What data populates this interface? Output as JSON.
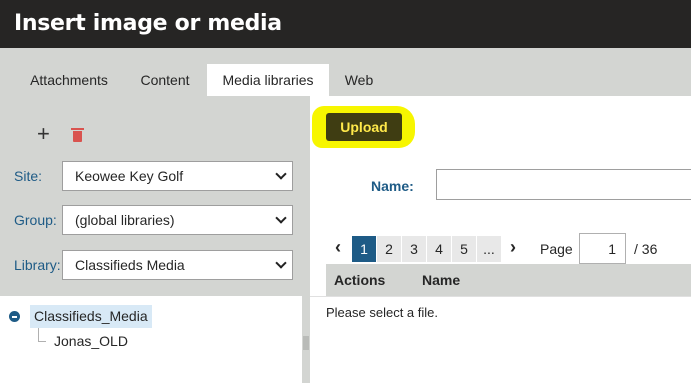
{
  "dialog": {
    "title": "Insert image or media"
  },
  "tabs": [
    {
      "label": "Attachments"
    },
    {
      "label": "Content"
    },
    {
      "label": "Media libraries"
    },
    {
      "label": "Web"
    }
  ],
  "active_tab": "Media libraries",
  "sidebar": {
    "fields": {
      "site": {
        "label": "Site:",
        "value": "Keowee Key Golf"
      },
      "group": {
        "label": "Group:",
        "value": "(global libraries)"
      },
      "library": {
        "label": "Library:",
        "value": "Classifieds Media"
      }
    },
    "tree": {
      "root": "Classifieds_Media",
      "children": [
        "Jonas_OLD"
      ]
    }
  },
  "main": {
    "upload_label": "Upload",
    "name_label": "Name:",
    "name_value": "",
    "pager": {
      "pages": [
        "1",
        "2",
        "3",
        "4",
        "5",
        "..."
      ],
      "current_page": "1",
      "page_label": "Page",
      "page_value": "1",
      "page_total": "/ 36",
      "prev_icon": "‹",
      "next_icon": "›"
    },
    "grid_headers": [
      "Actions",
      "Name"
    ],
    "empty_message": "Please select a file."
  },
  "colors": {
    "titlebar": "#262524",
    "panel": "#d3d5d2",
    "label_blue": "#1e5b86",
    "upload_bg": "#3f3d12",
    "upload_text": "#ffe94a",
    "highlight": "#f7f600",
    "delete_red": "#d9534f",
    "tree_selected": "#d8e9f6"
  }
}
